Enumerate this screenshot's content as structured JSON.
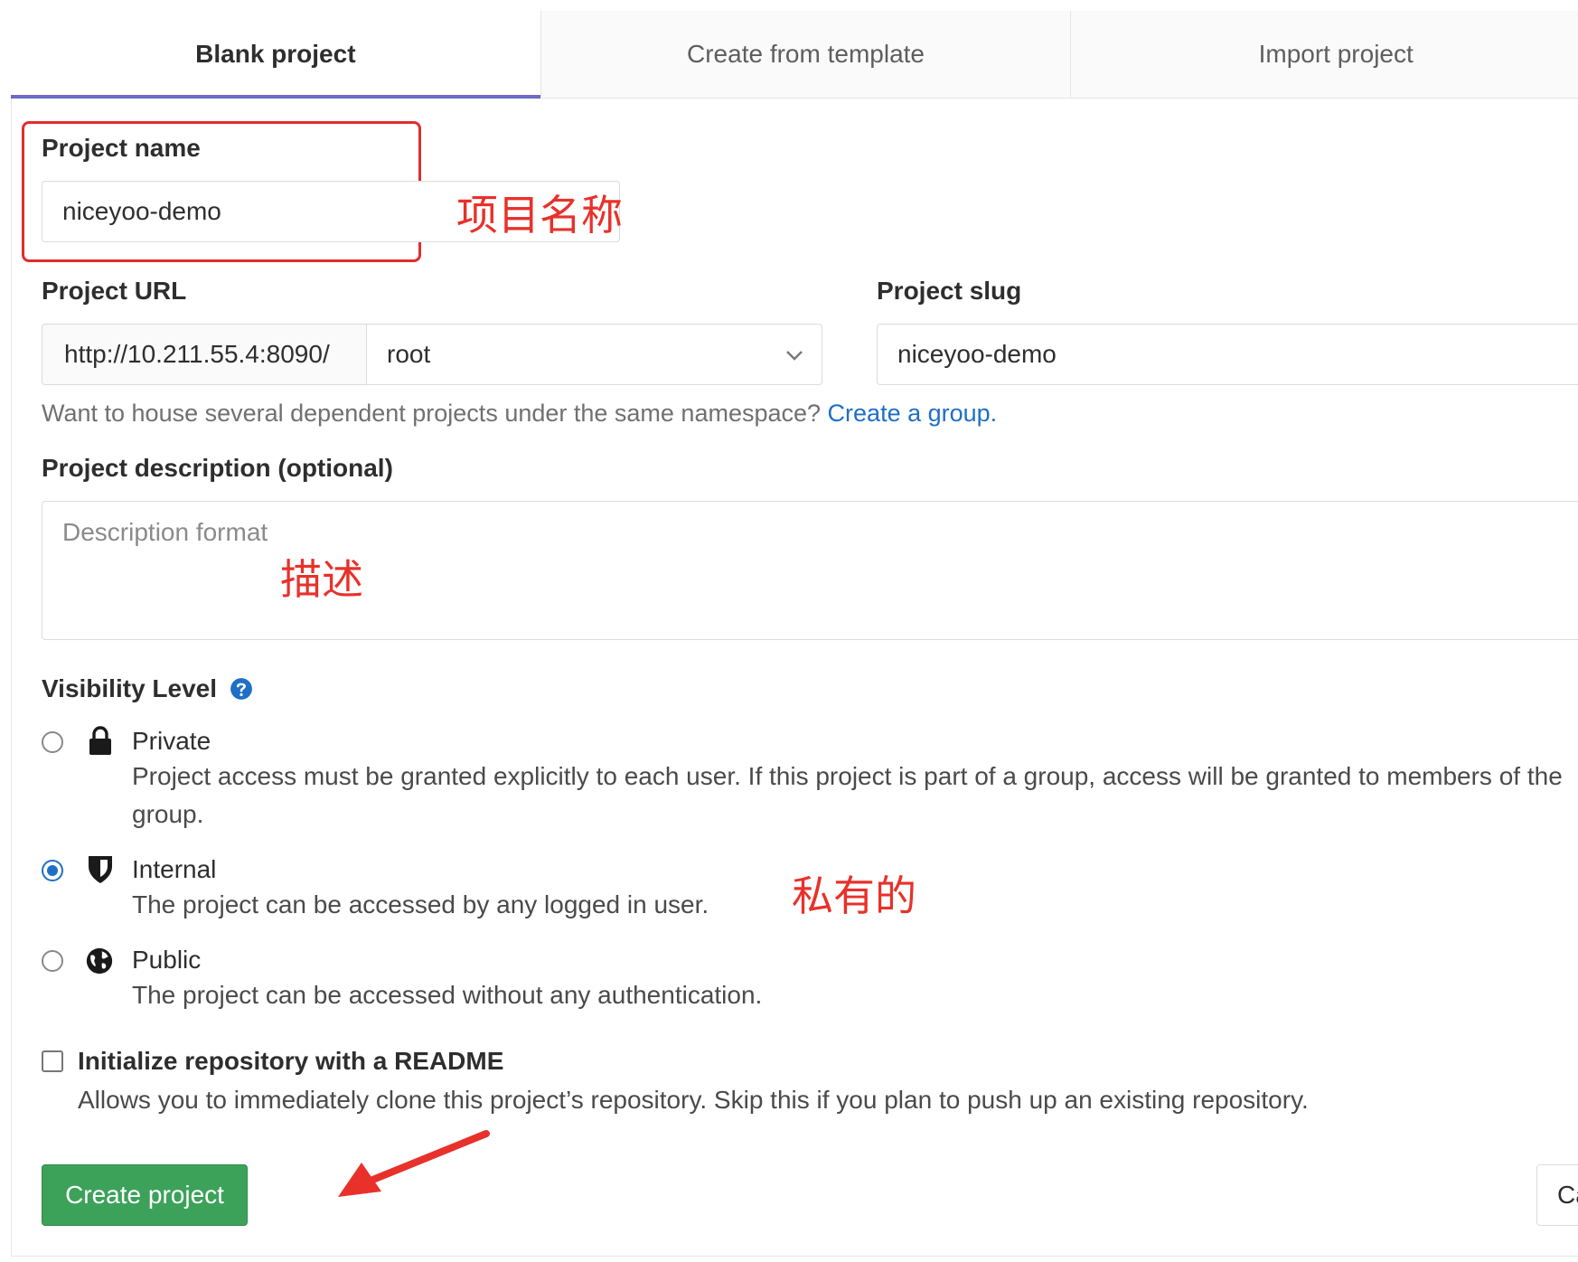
{
  "tabs": [
    {
      "label": "Blank project",
      "active": true
    },
    {
      "label": "Create from template",
      "active": false
    },
    {
      "label": "Import project",
      "active": false
    }
  ],
  "project_name": {
    "label": "Project name",
    "value": "niceyoo-demo"
  },
  "project_url": {
    "label": "Project URL",
    "prefix": "http://10.211.55.4:8090/",
    "namespace": "root"
  },
  "project_slug": {
    "label": "Project slug",
    "value": "niceyoo-demo"
  },
  "namespace_help": {
    "text": "Want to house several dependent projects under the same namespace? ",
    "link": "Create a group."
  },
  "description": {
    "label": "Project description (optional)",
    "placeholder": "Description format"
  },
  "visibility": {
    "label": "Visibility Level",
    "options": [
      {
        "title": "Private",
        "desc": "Project access must be granted explicitly to each user. If this project is part of a group, access will be granted to members of the group.",
        "checked": false
      },
      {
        "title": "Internal",
        "desc": "The project can be accessed by any logged in user.",
        "checked": true
      },
      {
        "title": "Public",
        "desc": "The project can be accessed without any authentication.",
        "checked": false
      }
    ]
  },
  "readme": {
    "label": "Initialize repository with a README",
    "desc": "Allows you to immediately clone this project’s repository. Skip this if you plan to push up an existing repository."
  },
  "buttons": {
    "create": "Create project",
    "cancel": "Cancel"
  },
  "annotations": {
    "name": "项目名称",
    "desc": "描述",
    "visibility": "私有的"
  },
  "colors": {
    "annotation": "#e8312a",
    "link": "#1f6fc5",
    "create_button": "#3ca25a",
    "tab_underline": "#6b6bc8"
  }
}
